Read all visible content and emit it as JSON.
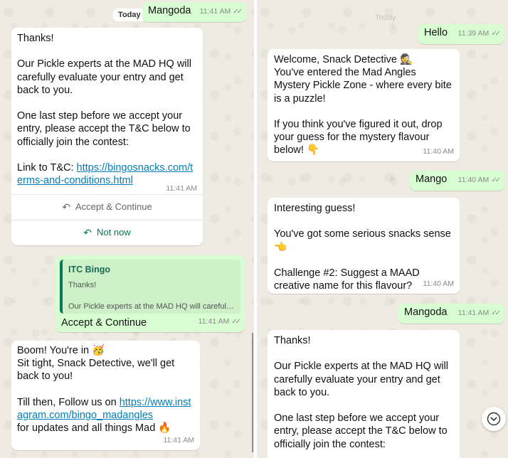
{
  "left": {
    "date_label": "Today",
    "top_out": {
      "text": "Mangoda",
      "time": "11:41 AM"
    },
    "thanks": {
      "text": "Thanks!\n\nOur Pickle experts at the MAD HQ will carefully evaluate your entry and get back to you.\n\nOne last step before we accept your entry, please accept the T&C below to officially join the contest:\n\n",
      "link_prefix": "Link to T&C: ",
      "link": "https://bingosnacks.com/terms-and-conditions.html",
      "time": "11:41 AM",
      "btn_accept": "Accept & Continue",
      "btn_notnow": "Not now",
      "btn_icon": "reply-icon"
    },
    "reply": {
      "quote_sender": "ITC Bingo",
      "quote_line1": "Thanks!",
      "quote_line2": "Our Pickle experts at the MAD HQ will carefully...",
      "text": "Accept & Continue",
      "time": "11:41 AM"
    },
    "boom": {
      "text": "Boom! You're in 🥳\nSit tight, Snack Detective, we'll get back to you!\n\nTill then, Follow us on ",
      "link": "https://www.instagram.com/bingo_madangles",
      "suffix": "\nfor updates and all things Mad 🔥",
      "time": "11:41 AM"
    }
  },
  "right": {
    "date_label": "Today",
    "hello": {
      "text": "Hello",
      "time": "11:39 AM"
    },
    "welcome": {
      "text": "Welcome, Snack Detective 🕵️\nYou've entered the Mad Angles Mystery Pickle Zone - where every bite is a puzzle!\n\nIf you think you've figured it out, drop your guess for the mystery flavour below! 👇",
      "time": "11:40 AM"
    },
    "mango": {
      "text": "Mango",
      "time": "11:40 AM"
    },
    "interesting": {
      "text": "Interesting guess!\n\nYou've got some serious snacks sense 👈\n\nChallenge #2: Suggest a MAAD creative name for this flavour?",
      "time": "11:40 AM"
    },
    "mangoda": {
      "text": "Mangoda",
      "time": "11:41 AM"
    },
    "thanks": {
      "text": "Thanks!\n\nOur Pickle experts at the MAD HQ will carefully evaluate your entry and get back to you.\n\nOne last step before we accept your entry, please accept the T&C below to officially join the contest:"
    },
    "scroll_icon": "chevron-down-icon"
  },
  "colors": {
    "outgoing": "#d9fdd3",
    "incoming": "#ffffff",
    "wallpaper": "#efeae2",
    "link": "#027eb5",
    "button": "#06775a"
  }
}
